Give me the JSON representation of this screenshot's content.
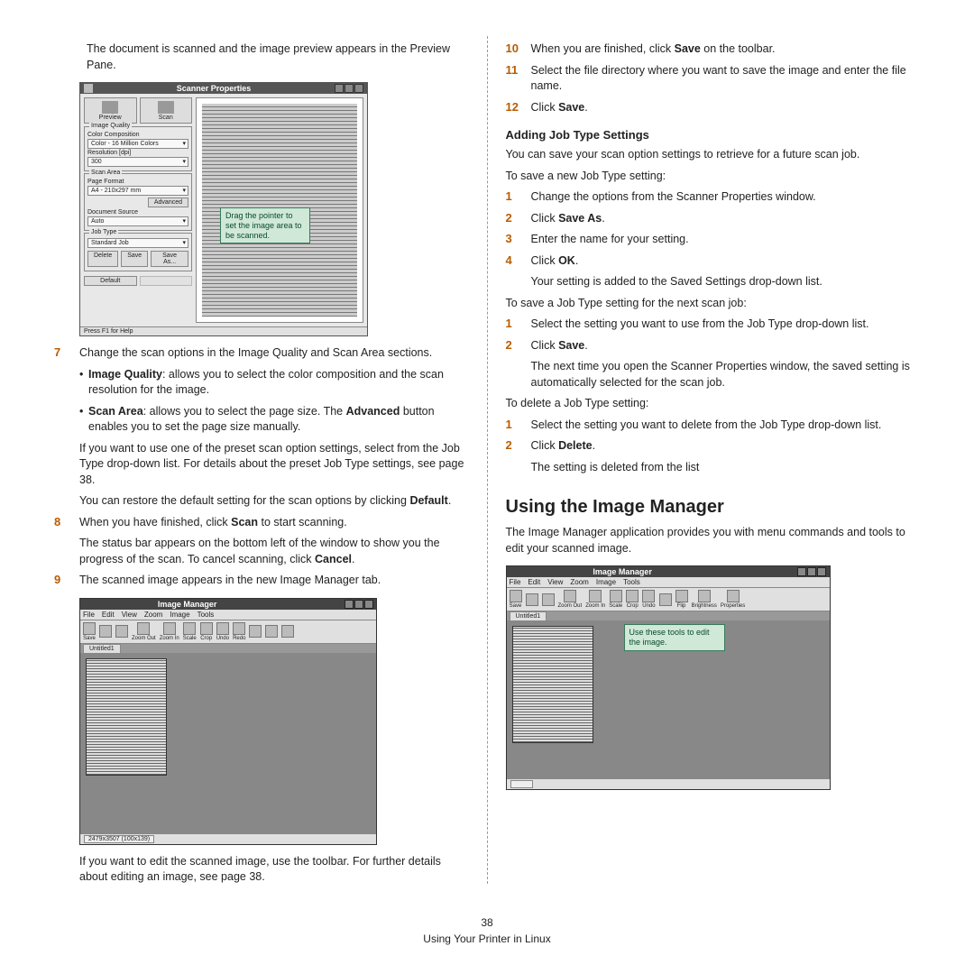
{
  "page_number": "38",
  "footer_text": "Using Your Printer in Linux",
  "left": {
    "intro": "The document is scanned and the image preview appears in the Preview Pane.",
    "scanner_window": {
      "title": "Scanner Properties",
      "preview_btn": "Preview",
      "scan_btn": "Scan",
      "grp_quality": "Image Quality",
      "lbl_color": "Color Composition",
      "val_color": "Color - 16 Million Colors",
      "lbl_res": "Resolution [dpi]",
      "val_res": "300",
      "grp_area": "Scan Area",
      "lbl_format": "Page Format",
      "val_format": "A4 - 210x297 mm",
      "btn_adv": "Advanced",
      "lbl_source": "Document Source",
      "val_source": "Auto",
      "grp_job": "Job Type",
      "val_job": "Standard Job",
      "btn_delete": "Delete",
      "btn_save": "Save",
      "btn_saveas": "Save As...",
      "btn_default": "Default",
      "status": "Press F1 for Help",
      "callout": "Drag the pointer to set the image area to be scanned."
    },
    "step7": "Change the scan options in the Image Quality and Scan Area sections.",
    "bullet1_b": "Image Quality",
    "bullet1_t": ": allows you to select the color composition and the scan resolution for the image.",
    "bullet2_b": "Scan Area",
    "bullet2_t1": ": allows you to select the page size. The ",
    "bullet2_adv": "Advanced",
    "bullet2_t2": " button enables you to set the page size manually.",
    "para_preset": "If you want to use one of the preset scan option settings, select from the Job Type drop-down list. For details about the preset Job Type settings, see page 38.",
    "para_default1": "You can restore the default setting for the scan options by clicking ",
    "para_default_b": "Default",
    "step8_a": "When you have finished, click ",
    "step8_b": "Scan",
    "step8_c": " to start scanning.",
    "para_status1": "The status bar appears on the bottom left of the window to show you the progress of the scan. To cancel scanning, click ",
    "para_status_b": "Cancel",
    "step9": "The scanned image appears in the new Image Manager tab.",
    "im_left": {
      "title": "Image Manager",
      "menu": [
        "File",
        "Edit",
        "View",
        "Zoom",
        "Image",
        "Tools"
      ],
      "tools": [
        "Save",
        "",
        "",
        "Zoom Out",
        "Zoom In",
        "Scale",
        "Crop",
        "Undo",
        "Redo",
        "",
        "",
        ""
      ],
      "tab": "Untitled1",
      "status": "2479x3507 (100x139)"
    },
    "para_edit": "If you want to edit the scanned image, use the toolbar. For further details about editing an image, see page 38."
  },
  "right": {
    "step10_a": "When you are finished, click ",
    "step10_b": "Save",
    "step10_c": " on the toolbar.",
    "step11": "Select the file directory where you want to save the image and enter the file name.",
    "step12_a": "Click ",
    "step12_b": "Save",
    "h_add": "Adding Job Type Settings",
    "p_add": "You can save your scan option settings to retrieve for a future scan job.",
    "p_save_new": "To save a new Job Type setting:",
    "s1": "Change the options from the Scanner Properties window.",
    "s2_a": "Click ",
    "s2_b": "Save As",
    "s3": "Enter the name for your setting.",
    "s4_a": "Click ",
    "s4_b": "OK",
    "s4_after": "Your setting is added to the Saved Settings drop-down list.",
    "p_save_next": "To save a Job Type setting for the next scan job:",
    "n1": "Select the setting you want to use from the Job Type drop-down list.",
    "n2_a": "Click ",
    "n2_b": "Save",
    "n2_after": "The next time you open the Scanner Properties window, the saved setting is automatically selected for the scan job.",
    "p_delete": "To delete a Job Type setting:",
    "d1": "Select the setting you want to delete from the Job Type drop-down list.",
    "d2_a": "Click ",
    "d2_b": "Delete",
    "d2_after": "The setting is deleted from the list",
    "h_using": "Using the Image Manager",
    "p_using": "The Image Manager application provides you with menu commands and tools to edit your scanned image.",
    "im_right": {
      "title": "Image Manager",
      "menu": [
        "File",
        "Edit",
        "View",
        "Zoom",
        "Image",
        "Tools"
      ],
      "tools": [
        "Save",
        "",
        "",
        "Zoom Out",
        "Zoom In",
        "Scale",
        "Crop",
        "Undo",
        "",
        "Flip",
        "Brightness",
        "Properties"
      ],
      "tab": "Untitled1",
      "status": "",
      "callout": "Use these tools to edit the image."
    }
  }
}
